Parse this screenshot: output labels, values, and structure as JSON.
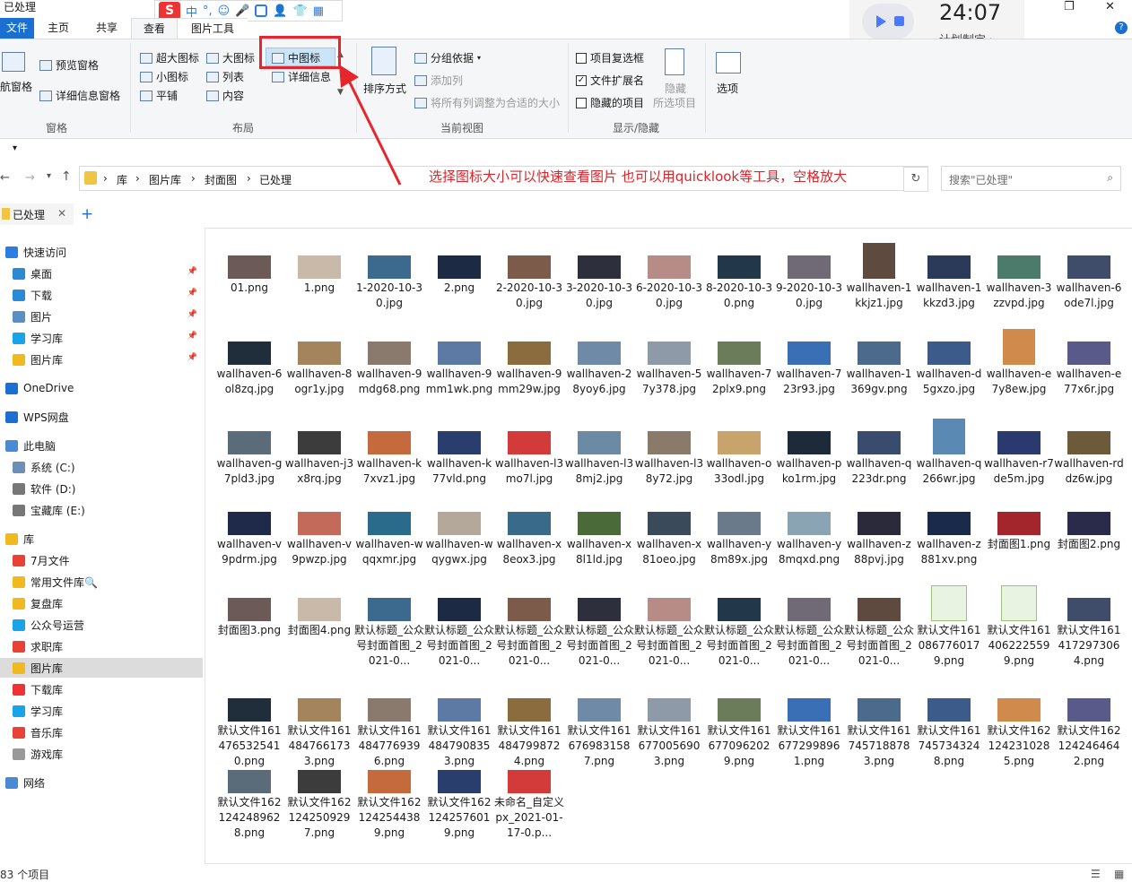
{
  "window": {
    "title": "已处理",
    "minimize": "—",
    "restore": "❐",
    "close": "✕",
    "help": "?"
  },
  "ime": {
    "s": "S",
    "zh": "中"
  },
  "clock": {
    "time": "24:07",
    "plan": "计划制定 ›"
  },
  "tabs": {
    "file": "文件",
    "home": "主页",
    "share": "共享",
    "view": "查看",
    "picture_tools": "图片工具"
  },
  "ribbon": {
    "pane": {
      "preview": "预览窗格",
      "nav": "导航窗格",
      "details": "详细信息窗格",
      "label": "窗格"
    },
    "layout": {
      "xl": "超大图标",
      "large": "大图标",
      "medium": "中图标",
      "small": "小图标",
      "list": "列表",
      "details": "详细信息",
      "tiles": "平铺",
      "content": "内容",
      "label": "布局"
    },
    "current_view": {
      "sort": "排序方式",
      "group": "分组依据",
      "add_col": "添加列",
      "fit_cols": "将所有列调整为合适的大小",
      "label": "当前视图"
    },
    "show_hide": {
      "checkboxes": "项目复选框",
      "extensions": "文件扩展名",
      "hidden": "隐藏的项目",
      "hide_sel_1": "隐藏",
      "hide_sel_2": "所选项目",
      "label": "显示/隐藏"
    },
    "options": "选项"
  },
  "address": {
    "crumbs": [
      "库",
      "图片库",
      "封面图",
      "已处理"
    ]
  },
  "search": {
    "placeholder": "搜索\"已处理\""
  },
  "annotation": "选择图标大小可以快速查看图片 也可以用quicklook等工具，空格放大",
  "subtab": {
    "label": "已处理"
  },
  "nav": [
    {
      "label": "快速访问",
      "icon": "star",
      "color": "#2a7de1"
    },
    {
      "label": "桌面",
      "icon": "desktop",
      "color": "#2a8ad4",
      "pin": true
    },
    {
      "label": "下载",
      "icon": "download",
      "color": "#2a8ad4",
      "pin": true
    },
    {
      "label": "图片",
      "icon": "pictures",
      "color": "#5a8fc4",
      "pin": true
    },
    {
      "label": "学习库",
      "icon": "library",
      "color": "#1aa3e8",
      "pin": true
    },
    {
      "label": "图片库",
      "icon": "library",
      "color": "#f0b91e",
      "pin": true
    },
    {
      "label": "OneDrive",
      "icon": "cloud",
      "color": "#1a6fd1"
    },
    {
      "label": "WPS网盘",
      "icon": "cloud",
      "color": "#1a6fd1"
    },
    {
      "label": "此电脑",
      "icon": "pc",
      "color": "#4a8ad4"
    },
    {
      "label": "系统 (C:)",
      "icon": "drive",
      "color": "#6b8fb5"
    },
    {
      "label": "软件 (D:)",
      "icon": "drive",
      "color": "#777"
    },
    {
      "label": "宝藏库 (E:)",
      "icon": "drive",
      "color": "#777"
    },
    {
      "label": "库",
      "icon": "folder",
      "color": "#f0b91e"
    },
    {
      "label": "7月文件",
      "icon": "chrome",
      "color": "#e94235"
    },
    {
      "label": "常用文件库🔍",
      "icon": "library",
      "color": "#f0b91e"
    },
    {
      "label": "复盘库",
      "icon": "library",
      "color": "#f0b91e"
    },
    {
      "label": "公众号运营",
      "icon": "library",
      "color": "#1aa3e8"
    },
    {
      "label": "求职库",
      "icon": "chrome",
      "color": "#e94235"
    },
    {
      "label": "图片库",
      "icon": "library",
      "color": "#f0b91e",
      "selected": true
    },
    {
      "label": "下载库",
      "icon": "library",
      "color": "#e33"
    },
    {
      "label": "学习库",
      "icon": "library",
      "color": "#1aa3e8"
    },
    {
      "label": "音乐库",
      "icon": "library",
      "color": "#e94235"
    },
    {
      "label": "游戏库",
      "icon": "library",
      "color": "#999"
    },
    {
      "label": "网络",
      "icon": "network",
      "color": "#4a8ad4"
    }
  ],
  "files": [
    [
      "01.png",
      "1.png",
      "1-2020-10-30.jpg",
      "2.png",
      "2-2020-10-30.jpg",
      "3-2020-10-30.jpg",
      "6-2020-10-30.jpg",
      "8-2020-10-30.png",
      "9-2020-10-30.jpg",
      "wallhaven-1kkjz1.jpg",
      "wallhaven-1kkzd3.jpg",
      "wallhaven-3zzvpd.jpg",
      "wallhaven-6ode7l.jpg"
    ],
    [
      "wallhaven-6ol8zq.jpg",
      "wallhaven-8ogr1y.jpg",
      "wallhaven-9mdg68.png",
      "wallhaven-9mm1wk.png",
      "wallhaven-9mm29w.jpg",
      "wallhaven-28yoy6.jpg",
      "wallhaven-57y378.jpg",
      "wallhaven-72plx9.png",
      "wallhaven-723r93.jpg",
      "wallhaven-1369gv.png",
      "wallhaven-d5gxzo.jpg",
      "wallhaven-e7y8ew.jpg",
      "wallhaven-e77x6r.jpg"
    ],
    [
      "wallhaven-g7pld3.jpg",
      "wallhaven-j3x8rq.jpg",
      "wallhaven-k7xvz1.jpg",
      "wallhaven-k77vld.png",
      "wallhaven-l3mo7l.jpg",
      "wallhaven-l38mj2.jpg",
      "wallhaven-l38y72.jpg",
      "wallhaven-o33odl.jpg",
      "wallhaven-pko1rm.jpg",
      "wallhaven-q223dr.png",
      "wallhaven-q266wr.jpg",
      "wallhaven-r7de5m.jpg",
      "wallhaven-rddz6w.jpg"
    ],
    [
      "wallhaven-v9pdrm.jpg",
      "wallhaven-v9pwzp.jpg",
      "wallhaven-wqqxmr.jpg",
      "wallhaven-wqygwx.jpg",
      "wallhaven-x8eox3.jpg",
      "wallhaven-x8l1ld.jpg",
      "wallhaven-x81oeo.jpg",
      "wallhaven-y8m89x.jpg",
      "wallhaven-y8mqxd.png",
      "wallhaven-z88pvj.jpg",
      "wallhaven-z881xv.png",
      "封面图1.png",
      "封面图2.png"
    ],
    [
      "封面图3.png",
      "封面图4.png",
      "默认标题_公众号封面首图_2021-0...",
      "默认标题_公众号封面首图_2021-0...",
      "默认标题_公众号封面首图_2021-0...",
      "默认标题_公众号封面首图_2021-0...",
      "默认标题_公众号封面首图_2021-0...",
      "默认标题_公众号封面首图_2021-0...",
      "默认标题_公众号封面首图_2021-0...",
      "默认标题_公众号封面首图_2021-0...",
      "默认文件1610867760179.png",
      "默认文件1614062225599.png",
      "默认文件1614172973064.png"
    ],
    [
      "默认文件1614765325410.png",
      "默认文件1614847661733.png",
      "默认文件1614847769396.png",
      "默认文件1614847908353.png",
      "默认文件1614847998724.png",
      "默认文件1616769831587.png",
      "默认文件1616770056903.png",
      "默认文件1616770962029.png",
      "默认文件1616772998961.png",
      "默认文件1617457188783.png",
      "默认文件1617457343248.png",
      "默认文件1621242310285.png",
      "默认文件1621242464642.png"
    ],
    [
      "默认文件1621242489628.png",
      "默认文件1621242509297.png",
      "默认文件1621242544389.png",
      "默认文件1621242576019.png",
      "未命名_自定义px_2021-01-17-0.p..."
    ]
  ],
  "thumb_colors": [
    "#6b5a58",
    "#c9b9a8",
    "#3c6a8e",
    "#1c2a44",
    "#7d5b4a",
    "#2e2f3c",
    "#b88c86",
    "#22374a",
    "#6f6a75",
    "#5e4a3e",
    "#2b3a58",
    "#4c7a6b",
    "#3f4d6b",
    "#1f2e3a",
    "#a4845c",
    "#8a7a6d",
    "#5c7aa3",
    "#8a6c3e",
    "#6e8aa6",
    "#8e9aa8",
    "#6b7c5a",
    "#3a6eb5",
    "#4c6a8c",
    "#3c5a8a",
    "#d08b4c",
    "#5a5a8a",
    "#5a6c7a",
    "#3c3c3c",
    "#c46a3c",
    "#2a3e6e",
    "#d33a3a",
    "#6c8aa4",
    "#8a7a6a",
    "#c8a46c",
    "#1c2a3a",
    "#3a4c6e",
    "#5a8ab4",
    "#2a3a6e",
    "#6c5a3a",
    "#1f2a4a",
    "#c46a5a",
    "#2a6a8a",
    "#b4a89a",
    "#3a6a8a",
    "#4a6a3a",
    "#3a4a5a",
    "#6a7a8a",
    "#8aa4b4",
    "#2a2a3a",
    "#1a2a4a",
    "#a3262c",
    "#2a2a4a"
  ],
  "status": {
    "count": "83 个项目"
  }
}
